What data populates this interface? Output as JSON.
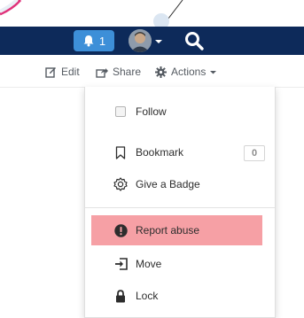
{
  "header": {
    "notifications_count": "1",
    "icons": {
      "bell": "bell-icon",
      "avatar_caret": "chevron-down-icon",
      "search": "search-icon"
    },
    "colors": {
      "header_bg": "#0d2a5a",
      "notif_bg": "#3d8fd8"
    }
  },
  "post_actions": {
    "edit_label": "Edit",
    "share_label": "Share",
    "actions_label": "Actions",
    "icons": {
      "edit": "edit-icon",
      "share": "share-icon",
      "actions": "gear-icon",
      "actions_caret": "chevron-down-icon"
    }
  },
  "menu": {
    "items": [
      {
        "label": "Follow",
        "icon": "checkbox-icon"
      },
      {
        "label": "Bookmark",
        "icon": "bookmark-icon",
        "count": "0"
      },
      {
        "label": "Give a Badge",
        "icon": "badge-icon"
      },
      {
        "label": "Report abuse",
        "icon": "exclamation-circle-icon",
        "highlighted": true,
        "highlight_color": "#f6a0a5"
      },
      {
        "label": "Move",
        "icon": "move-icon"
      },
      {
        "label": "Lock",
        "icon": "lock-icon"
      }
    ]
  }
}
